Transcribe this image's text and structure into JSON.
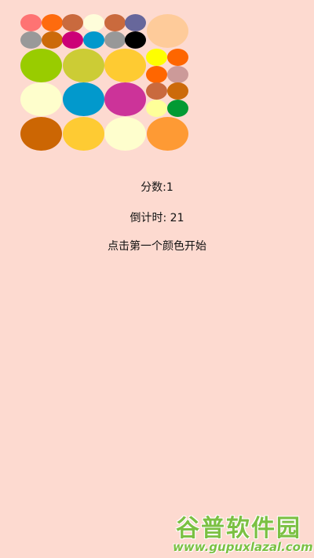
{
  "game": {
    "score_label": "分数:1",
    "countdown_label": "倒计时: 21",
    "hint": "点击第一个颜色开始"
  },
  "grid_colors": {
    "small_top": [
      "#FE7373",
      "#FE6B0E",
      "#C96A3E",
      "#FEFDDA",
      "#CA6A3D",
      "#67679B",
      "#999999",
      "#CC6A0A",
      "#CC0077",
      "#0298CC",
      "#989898",
      "#000000"
    ],
    "top_right_large": "#FECB9A",
    "large_rows": [
      [
        "#99CC00",
        "#CCCC35",
        "#FECB32"
      ],
      [
        "#FEFECC",
        "#0299CC",
        "#CC3399"
      ],
      [
        "#CC6603",
        "#FECB33",
        "#FEFECD",
        "#FE9A34"
      ]
    ],
    "small_right": [
      "#FEFF00",
      "#FE6600",
      "#FF6600",
      "#CC9A99",
      "#C96A3E",
      "#CC6A0A",
      "#FEFF99",
      "#029A33"
    ]
  },
  "watermark": {
    "title": "谷普软件园",
    "url": "www.gupuxlazal.com"
  }
}
